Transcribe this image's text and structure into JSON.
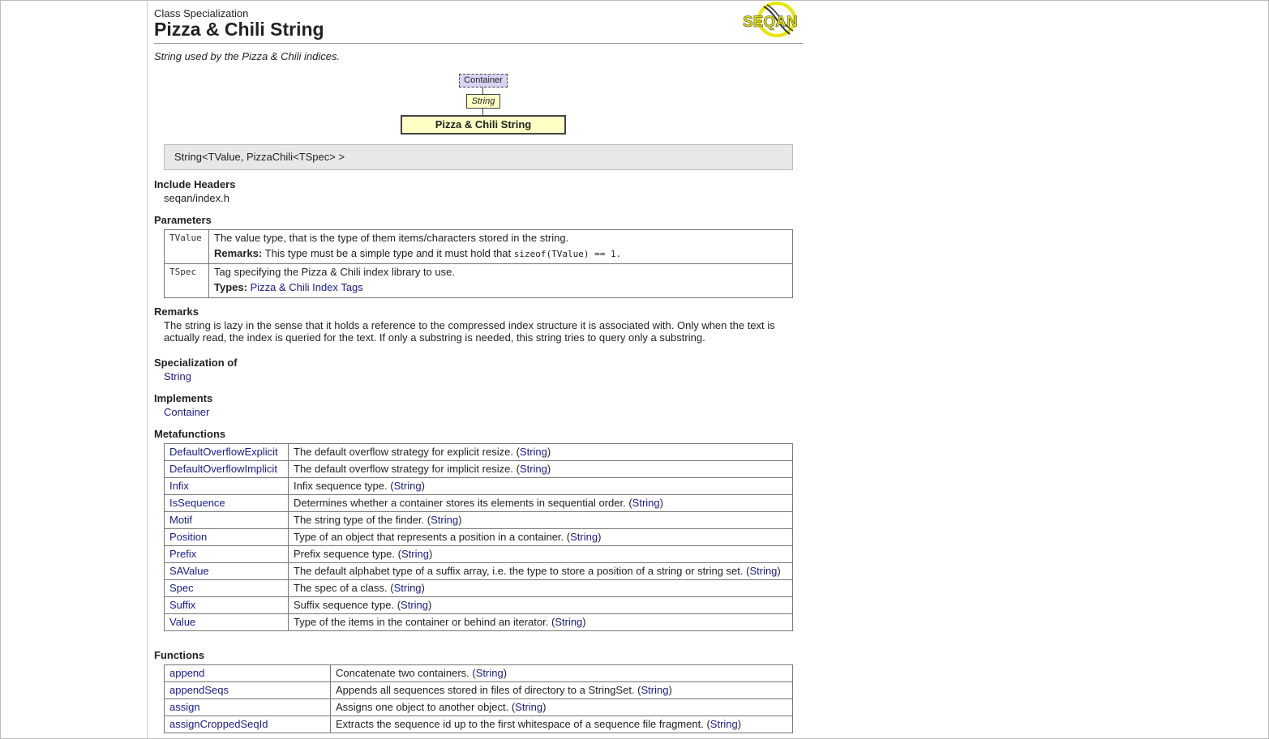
{
  "header": {
    "kind": "Class Specialization",
    "title": "Pizza & Chili String",
    "logo_text": "SEQAN"
  },
  "summary": "String used by the Pizza & Chili indices.",
  "diagram": {
    "container": "Container",
    "string": "String",
    "current": "Pizza & Chili String"
  },
  "signature": "String<TValue, PizzaChili<TSpec> >",
  "include": {
    "heading": "Include Headers",
    "value": "seqan/index.h"
  },
  "parameters": {
    "heading": "Parameters",
    "rows": [
      {
        "name": "TValue",
        "desc": "The value type, that is the type of them items/characters stored in the string.",
        "remarks_label": "Remarks:",
        "remarks_text": "This type must be a simple type and it must hold that ",
        "remarks_code": "sizeof(TValue) == 1."
      },
      {
        "name": "TSpec",
        "desc": "Tag specifying the Pizza & Chili index library to use.",
        "types_label": "Types:",
        "types_link": "Pizza & Chili Index Tags"
      }
    ]
  },
  "remarks": {
    "heading": "Remarks",
    "text": "The string is lazy in the sense that it holds a reference to the compressed index structure it is associated with. Only when the text is actually read, the index is queried for the text. If only a substring is needed, this string tries to query only a substring."
  },
  "specialization": {
    "heading": "Specialization of",
    "link": "String"
  },
  "implements": {
    "heading": "Implements",
    "link": "Container"
  },
  "metafunctions": {
    "heading": "Metafunctions",
    "rows": [
      {
        "name": "DefaultOverflowExplicit",
        "desc": "The default overflow strategy for explicit resize. ",
        "ref": "String"
      },
      {
        "name": "DefaultOverflowImplicit",
        "desc": "The default overflow strategy for implicit resize. ",
        "ref": "String"
      },
      {
        "name": "Infix",
        "desc": "Infix sequence type. ",
        "ref": "String"
      },
      {
        "name": "IsSequence",
        "desc": "Determines whether a container stores its elements in sequential order. ",
        "ref": "String"
      },
      {
        "name": "Motif",
        "desc": "The string type of the finder. ",
        "ref": "String"
      },
      {
        "name": "Position",
        "desc": "Type of an object that represents a position in a container. ",
        "ref": "String"
      },
      {
        "name": "Prefix",
        "desc": "Prefix sequence type. ",
        "ref": "String"
      },
      {
        "name": "SAValue",
        "desc": "The default alphabet type of a suffix array, i.e. the type to store a position of a string or string set. ",
        "ref": "String"
      },
      {
        "name": "Spec",
        "desc": "The spec of a class. ",
        "ref": "String"
      },
      {
        "name": "Suffix",
        "desc": "Suffix sequence type. ",
        "ref": "String"
      },
      {
        "name": "Value",
        "desc": "Type of the items in the container or behind an iterator. ",
        "ref": "String"
      }
    ]
  },
  "functions": {
    "heading": "Functions",
    "rows": [
      {
        "name": "append",
        "desc": "Concatenate two containers. ",
        "ref": "String"
      },
      {
        "name": "appendSeqs",
        "desc": "Appends all sequences stored in files of directory to a StringSet. ",
        "ref": "String"
      },
      {
        "name": "assign",
        "desc": "Assigns one object to another object. ",
        "ref": "String"
      },
      {
        "name": "assignCroppedSeqId",
        "desc": "Extracts the sequence id up to the first whitespace of a sequence file fragment. ",
        "ref": "String"
      }
    ]
  },
  "colors": {
    "link": "#1a1a8c",
    "diagram_container_bg": "#d8d4f4",
    "diagram_string_bg": "#fdfdc4",
    "signature_bg": "#e8e8e8",
    "logo_yellow": "#e6e600"
  }
}
